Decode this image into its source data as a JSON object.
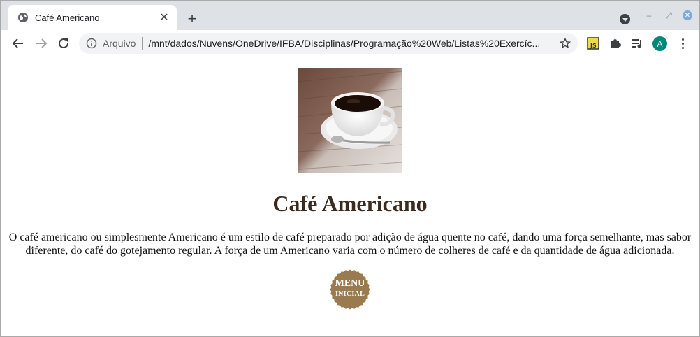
{
  "browser": {
    "tab": {
      "title": "Café Americano",
      "favicon": "globe-icon",
      "close_icon": "close-icon"
    },
    "new_tab_icon": "plus-icon",
    "toolbar": {
      "back_icon": "back-arrow-icon",
      "forward_icon": "forward-arrow-icon",
      "reload_icon": "reload-icon",
      "address": {
        "info_icon": "info-icon",
        "scheme_label": "Arquivo",
        "url": "/mnt/dados/Nuvens/OneDrive/IFBA/Disciplinas/Programação%20Web/Listas%20Exercíc...",
        "bookmark_icon": "star-icon"
      },
      "extensions": [
        "js-extension-icon",
        "puzzle-icon",
        "media-queue-icon"
      ],
      "avatar_letter": "A",
      "avatar_color": "#00897b",
      "menu_icon": "kebab-menu-icon"
    }
  },
  "page": {
    "image_alt": "coffee-cup-image",
    "heading": "Café Americano",
    "paragraph": "O café americano ou simplesmente Americano é um estilo de café preparado por adição de água quente no café, dando uma força semelhante, mas sabor diferente, do café do gotejamento regular. A força de um Americano varia com o número de colheres de café e da quantidade de água adicionada.",
    "menu_button": {
      "line1": "MENU",
      "line2": "INICIAL",
      "color": "#9a7b4f"
    },
    "heading_color": "#3b2a1e"
  }
}
